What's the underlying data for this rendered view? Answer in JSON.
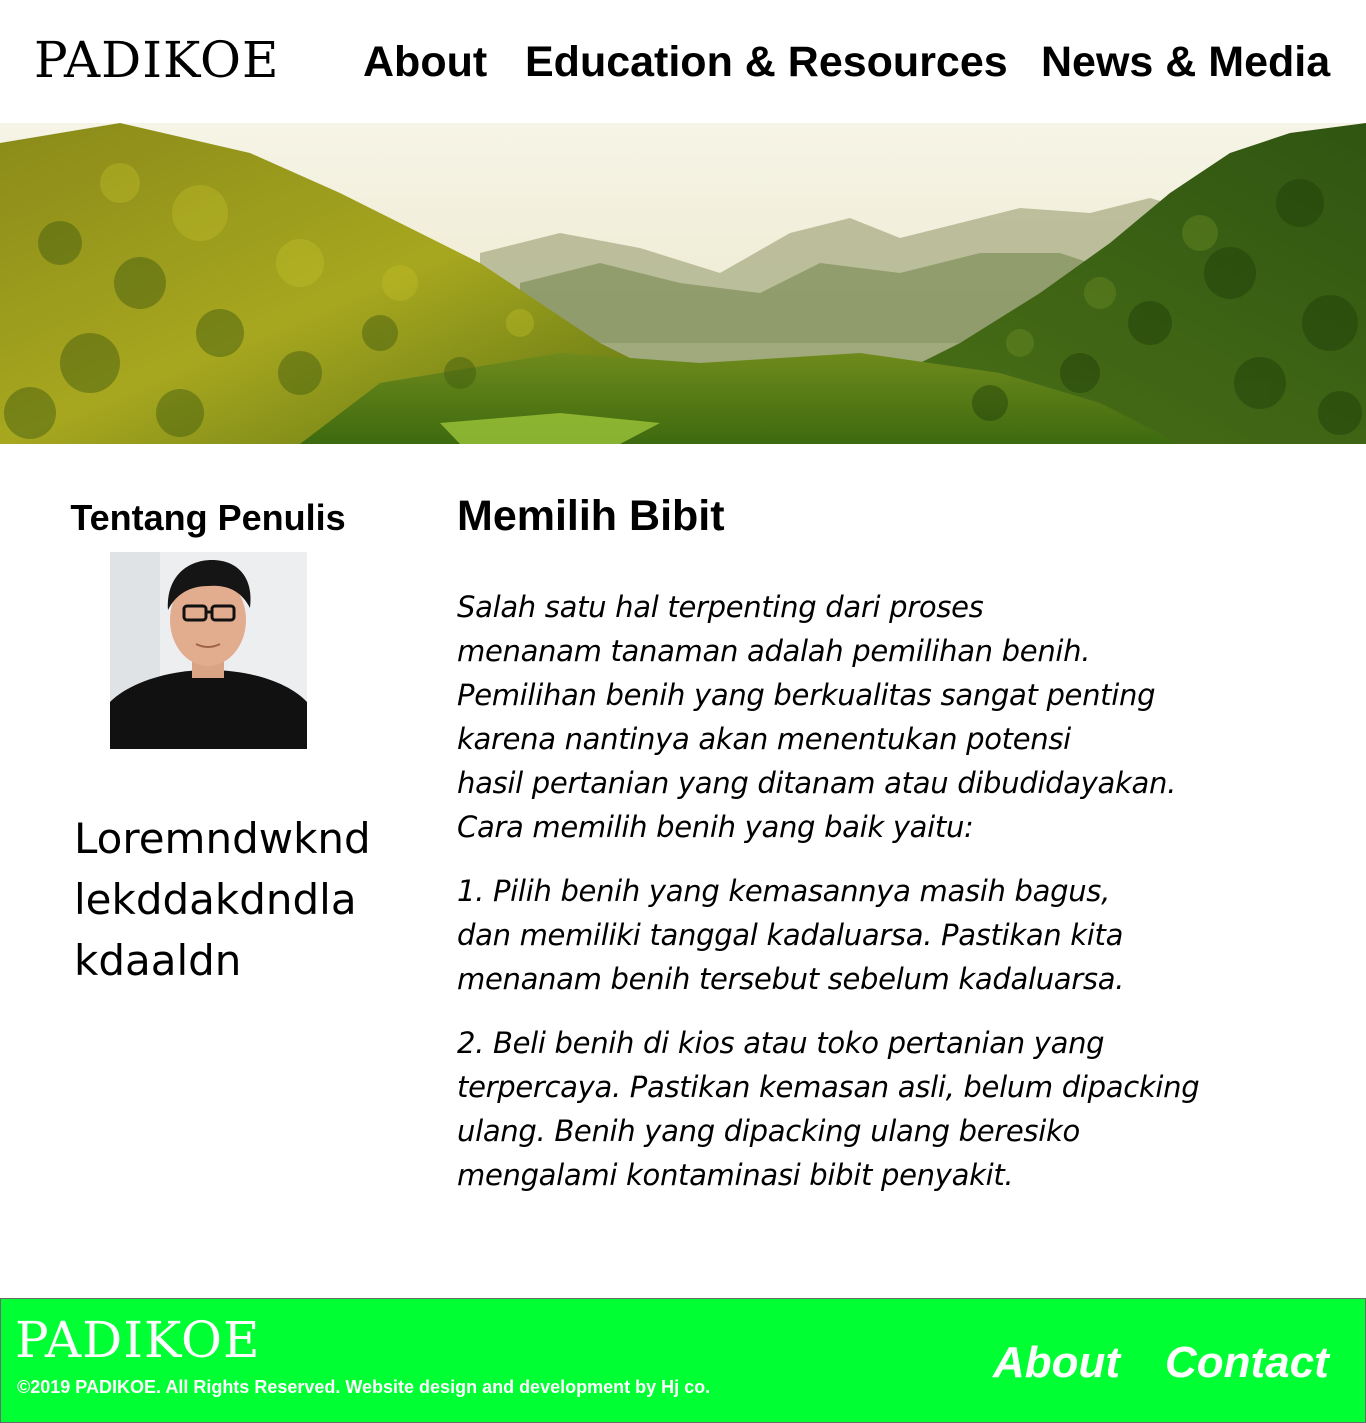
{
  "header": {
    "logo": "PADIKOE",
    "nav": {
      "about": "About",
      "education": "Education & Resources",
      "news": "News & Media"
    }
  },
  "hero": {
    "icon": "forest-mountain-image"
  },
  "sidebar": {
    "title": "Tentang Penulis",
    "avatar_icon": "author-photo",
    "bio": "Loremndwkndlekddakdndlakdaaldn"
  },
  "article": {
    "title": "Memilih Bibit",
    "paragraphs": [
      "Salah satu hal terpenting dari proses\nmenanam tanaman adalah pemilihan benih.\nPemilihan benih yang berkualitas sangat penting\nkarena nantinya akan menentukan potensi\nhasil pertanian yang ditanam atau dibudidayakan.\nCara memilih benih yang baik yaitu:",
      "1. Pilih benih yang kemasannya masih bagus,\ndan memiliki tanggal kadaluarsa. Pastikan kita\nmenanam benih tersebut sebelum kadaluarsa.",
      "2. Beli benih di kios atau toko pertanian yang\nterpercaya. Pastikan kemasan asli, belum dipacking\nulang. Benih yang dipacking ulang beresiko\nmengalami kontaminasi bibit penyakit."
    ]
  },
  "footer": {
    "logo": "PADIKOE",
    "copyright": "©2019 PADIKOE. All Rights Reserved. Website design and development by Hj co.",
    "nav": {
      "about": "About",
      "contact": "Contact"
    },
    "background_color": "#00ff33"
  }
}
